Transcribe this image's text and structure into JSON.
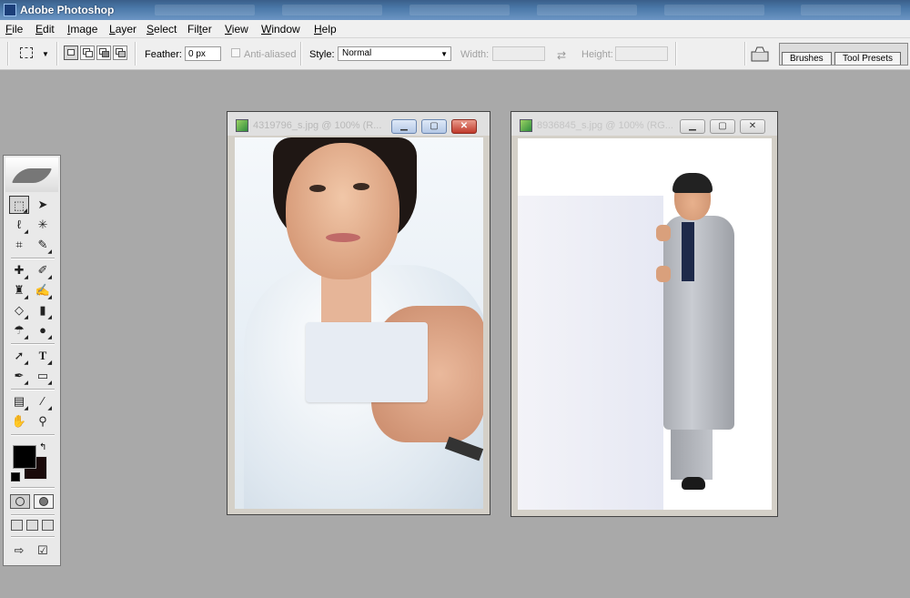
{
  "app": {
    "title": "Adobe Photoshop"
  },
  "menu": [
    "File",
    "Edit",
    "Image",
    "Layer",
    "Select",
    "Filter",
    "View",
    "Window",
    "Help"
  ],
  "menu_mnemonic": [
    "F",
    "E",
    "I",
    "L",
    "S",
    "t",
    "V",
    "W",
    "H"
  ],
  "options": {
    "feather_label": "Feather:",
    "feather_value": "0 px",
    "antialiased_label": "Anti-aliased",
    "style_label": "Style:",
    "style_value": "Normal",
    "width_label": "Width:",
    "height_label": "Height:",
    "width_value": "",
    "height_value": ""
  },
  "palette_well": {
    "tabs": [
      "Brushes",
      "Tool Presets"
    ]
  },
  "documents": [
    {
      "name": "4319796_s.jpg @ 100% (R..."
    },
    {
      "name": "8936845_s.jpg @ 100% (RG..."
    }
  ],
  "colors": {
    "foreground": "#000000",
    "background": "#1a0a0a",
    "title_active": "#4a78a8",
    "close_red": "#c0392b"
  }
}
